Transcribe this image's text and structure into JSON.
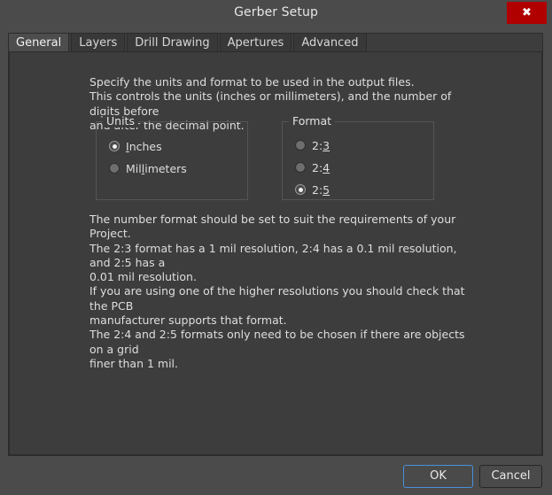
{
  "window": {
    "title": "Gerber Setup",
    "close_label": "✖",
    "close_icon": "close-icon"
  },
  "tabs": [
    {
      "label": "General",
      "active": true
    },
    {
      "label": "Layers",
      "active": false
    },
    {
      "label": "Drill Drawing",
      "active": false
    },
    {
      "label": "Apertures",
      "active": false
    },
    {
      "label": "Advanced",
      "active": false
    }
  ],
  "general": {
    "intro_text": "Specify the units and format to be used in the output files.\nThis controls the units (inches or millimeters), and the number of digits before\nand after the decimal point.",
    "units_group": {
      "title": "Units",
      "options": [
        {
          "label": "Inches",
          "mnemonic_index": 0,
          "checked": true
        },
        {
          "label": "Millimeters",
          "mnemonic_index": 3,
          "checked": false
        }
      ]
    },
    "format_group": {
      "title": "Format",
      "options": [
        {
          "label": "2:3",
          "mnemonic_index": 2,
          "checked": false
        },
        {
          "label": "2:4",
          "mnemonic_index": 2,
          "checked": false
        },
        {
          "label": "2:5",
          "mnemonic_index": 2,
          "checked": true
        }
      ]
    },
    "notes_text": "The number format should be set to suit the requirements of your Project.\nThe 2:3 format has a 1 mil resolution, 2:4 has a 0.1 mil resolution, and 2:5 has a\n0.01 mil resolution.\nIf you are using one of the higher resolutions you should check that the PCB\nmanufacturer supports that format.\nThe 2:4 and 2:5 formats only need to be chosen if there are objects on a grid\nfiner than 1 mil."
  },
  "footer": {
    "ok_label": "OK",
    "cancel_label": "Cancel"
  },
  "colors": {
    "window_bg": "#4b4b4b",
    "panel_bg": "#3d3d3d",
    "close_red": "#b00000",
    "focus_blue": "#4a90d9",
    "text": "#dedede"
  }
}
